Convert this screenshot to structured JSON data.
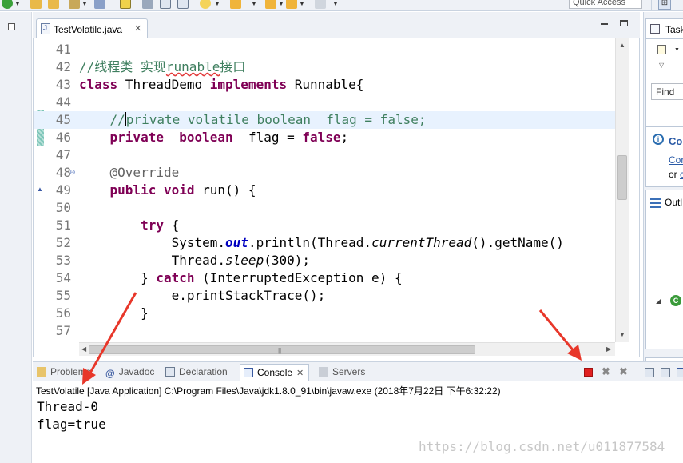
{
  "toolbar": {
    "quick_access_placeholder": "Quick Access"
  },
  "editor": {
    "tab_label": "TestVolatile.java",
    "lines": [
      {
        "num": "41",
        "tokens": []
      },
      {
        "num": "42",
        "tokens": [
          {
            "t": "//线程类 实现",
            "c": "cm"
          },
          {
            "t": "runable",
            "c": "cm squig"
          },
          {
            "t": "接口",
            "c": "cm"
          }
        ]
      },
      {
        "num": "43",
        "tokens": [
          {
            "t": "class",
            "c": "kw"
          },
          {
            "t": " ThreadDemo ",
            "c": ""
          },
          {
            "t": "implements",
            "c": "kw"
          },
          {
            "t": " Runnable{",
            "c": ""
          }
        ]
      },
      {
        "num": "44",
        "tokens": []
      },
      {
        "num": "45",
        "tokens": [
          {
            "t": "    //",
            "c": "cm"
          },
          {
            "t": "",
            "c": "caret"
          },
          {
            "t": "private volatile boolean  flag = false;",
            "c": "cm"
          }
        ]
      },
      {
        "num": "46",
        "tokens": [
          {
            "t": "    ",
            "c": ""
          },
          {
            "t": "private",
            "c": "kw"
          },
          {
            "t": "  ",
            "c": ""
          },
          {
            "t": "boolean",
            "c": "kw"
          },
          {
            "t": "  ",
            "c": ""
          },
          {
            "t": "flag",
            "c": "field"
          },
          {
            "t": " = ",
            "c": ""
          },
          {
            "t": "false",
            "c": "kw"
          },
          {
            "t": ";",
            "c": ""
          }
        ]
      },
      {
        "num": "47",
        "tokens": []
      },
      {
        "num": "48",
        "tokens": [
          {
            "t": "    @Override",
            "c": "an"
          }
        ]
      },
      {
        "num": "49",
        "tokens": [
          {
            "t": "    ",
            "c": ""
          },
          {
            "t": "public",
            "c": "kw"
          },
          {
            "t": " ",
            "c": ""
          },
          {
            "t": "void",
            "c": "kw"
          },
          {
            "t": " run() {",
            "c": ""
          }
        ]
      },
      {
        "num": "50",
        "tokens": []
      },
      {
        "num": "51",
        "tokens": [
          {
            "t": "        ",
            "c": ""
          },
          {
            "t": "try",
            "c": "kw"
          },
          {
            "t": " {",
            "c": ""
          }
        ]
      },
      {
        "num": "52",
        "tokens": [
          {
            "t": "            System.",
            "c": ""
          },
          {
            "t": "out",
            "c": "sf"
          },
          {
            "t": ".println(Thread.",
            "c": ""
          },
          {
            "t": "currentThread",
            "c": "it"
          },
          {
            "t": "().getName()",
            "c": ""
          }
        ]
      },
      {
        "num": "53",
        "tokens": [
          {
            "t": "            Thread.",
            "c": ""
          },
          {
            "t": "sleep",
            "c": "it"
          },
          {
            "t": "(300);",
            "c": ""
          }
        ]
      },
      {
        "num": "54",
        "tokens": [
          {
            "t": "        } ",
            "c": ""
          },
          {
            "t": "catch",
            "c": "kw"
          },
          {
            "t": " (InterruptedException e) {",
            "c": ""
          }
        ]
      },
      {
        "num": "55",
        "tokens": [
          {
            "t": "            e.printStackTrace();",
            "c": ""
          }
        ]
      },
      {
        "num": "56",
        "tokens": [
          {
            "t": "        }",
            "c": ""
          }
        ]
      },
      {
        "num": "57",
        "tokens": []
      }
    ]
  },
  "right_pane": {
    "task_tab_label": "Task",
    "find_placeholder": "Find",
    "connect_label": "Co",
    "connect_link": "Cor",
    "or_label": "or",
    "or_link_char": "c",
    "outline_label": "Outl"
  },
  "console": {
    "tabs": [
      {
        "label": "Problems"
      },
      {
        "label": "Javadoc"
      },
      {
        "label": "Declaration"
      },
      {
        "label": "Console"
      },
      {
        "label": "Servers"
      }
    ],
    "header": "TestVolatile [Java Application] C:\\Program Files\\Java\\jdk1.8.0_91\\bin\\javaw.exe (2018年7月22日 下午6:32:22)",
    "output": [
      "Thread-0",
      "flag=true"
    ]
  },
  "watermark": "https://blog.csdn.net/u011877584",
  "colors": {
    "keyword": "#7f0055",
    "comment": "#3f7f5f",
    "static_field": "#0000c0",
    "annotation_arrow": "#e8372a",
    "terminate_button": "#e02020"
  }
}
